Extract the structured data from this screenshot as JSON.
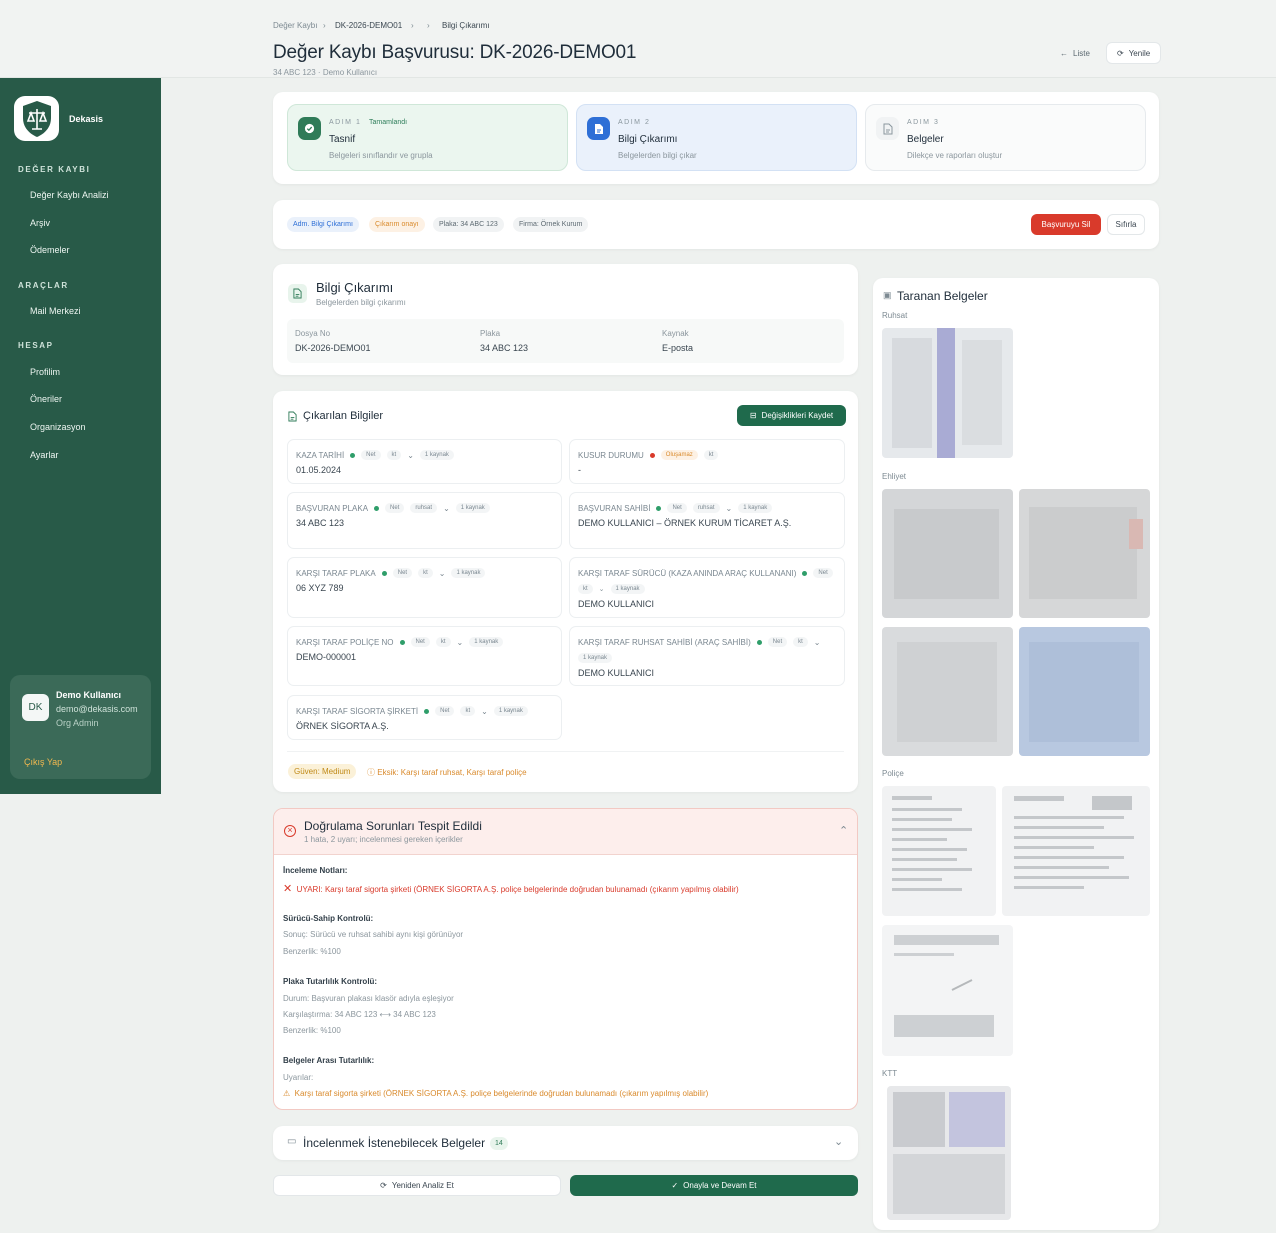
{
  "breadcrumb": {
    "items": [
      "Değer Kaybı",
      "DK-2026-DEMO01",
      "Bilgi Çıkarımı"
    ]
  },
  "header": {
    "title": "Değer Kaybı Başvurusu: DK-2026-DEMO01",
    "plate": "34 ABC 123",
    "user": "Demo Kullanıcı",
    "list_label": "Liste",
    "refresh_label": "Yenile"
  },
  "sidebar": {
    "brand": "Dekasis",
    "sections": [
      {
        "title": "DEĞER KAYBI",
        "items": [
          "Değer Kaybı Analizi",
          "Arşiv",
          "Ödemeler"
        ]
      },
      {
        "title": "ARAÇLAR",
        "items": [
          "Mail Merkezi"
        ]
      },
      {
        "title": "HESAP",
        "items": [
          "Profilim",
          "Öneriler",
          "Organizasyon",
          "Ayarlar"
        ]
      }
    ],
    "user": {
      "initials": "DK",
      "name": "Demo Kullanıcı",
      "email": "demo@dekasis.com",
      "role": "Org Admin",
      "logout": "Çıkış Yap"
    }
  },
  "steps": [
    {
      "label": "ADIM 1",
      "status": "Tamamlandı",
      "title": "Tasnif",
      "desc": "Belgeleri sınıflandır ve grupla"
    },
    {
      "label": "ADIM 2",
      "title": "Bilgi Çıkarımı",
      "desc": "Belgelerden bilgi çıkar"
    },
    {
      "label": "ADIM 3",
      "title": "Belgeler",
      "desc": "Dilekçe ve raporları oluştur"
    }
  ],
  "status_bar": {
    "pills": [
      "Adm. Bilgi Çıkarımı",
      "Çıkarım onayı",
      "Plaka: 34 ABC 123",
      "Firma: Örnek Kurum"
    ],
    "delete_label": "Başvuruyu Sil",
    "reset_label": "Sıfırla"
  },
  "info": {
    "title": "Bilgi Çıkarımı",
    "subtitle": "Belgelerden bilgi çıkarımı",
    "fields": [
      {
        "label": "Dosya No",
        "value": "DK-2026-DEMO01"
      },
      {
        "label": "Plaka",
        "value": "34 ABC 123"
      },
      {
        "label": "Kaynak",
        "value": "E-posta"
      }
    ]
  },
  "extracted": {
    "title": "Çıkarılan Bilgiler",
    "save_label": "Değişiklikleri Kaydet",
    "fields": [
      {
        "label": "KAZA TARİHİ",
        "tags": [
          "Net",
          "kt"
        ],
        "source": "1 kaynak",
        "value": "01.05.2024"
      },
      {
        "label": "KUSUR DURUMU",
        "status": "Oluşamaz",
        "tags": [
          "kt"
        ],
        "value": "-"
      },
      {
        "label": "BAŞVURAN PLAKA",
        "tags": [
          "Net",
          "ruhsat"
        ],
        "source": "1 kaynak",
        "value": "34 ABC 123"
      },
      {
        "label": "BAŞVURAN SAHİBİ",
        "tags": [
          "Net",
          "ruhsat"
        ],
        "source": "1 kaynak",
        "value": "DEMO KULLANICI – ÖRNEK KURUM TİCARET A.Ş."
      },
      {
        "label": "KARŞI TARAF PLAKA",
        "tags": [
          "Net",
          "kt"
        ],
        "source": "1 kaynak",
        "value": "06 XYZ 789"
      },
      {
        "label": "KARŞI TARAF SÜRÜCÜ (KAZA ANINDA ARAÇ KULLANANI)",
        "tags": [
          "Net",
          "kt"
        ],
        "source": "1 kaynak",
        "value": "DEMO KULLANICI"
      },
      {
        "label": "KARŞI TARAF POLİÇE NO",
        "tags": [
          "Net",
          "kt"
        ],
        "source": "1 kaynak",
        "value": "DEMO-000001"
      },
      {
        "label": "KARŞI TARAF RUHSAT SAHİBİ (ARAÇ SAHİBİ)",
        "tags": [
          "Net",
          "kt"
        ],
        "source": "1 kaynak",
        "value": "DEMO KULLANICI"
      },
      {
        "label": "KARŞI TARAF SİGORTA ŞİRKETİ",
        "tags": [
          "Net",
          "kt"
        ],
        "source": "1 kaynak",
        "value": "ÖRNEK SİGORTA A.Ş."
      }
    ],
    "confidence": "Güven: Medium",
    "missing": "Eksik: Karşı taraf ruhsat, Karşı taraf poliçe"
  },
  "validation": {
    "title": "Doğrulama Sorunları Tespit Edildi",
    "subtitle": "1 hata, 2 uyarı; incelenmesi gereken içerikler",
    "review_title": "İnceleme Notları:",
    "review_error": "UYARI: Karşı taraf sigorta şirketi (ÖRNEK SİGORTA A.Ş. poliçe belgelerinde doğrudan bulunamadı (çıkarım yapılmış olabilir)",
    "driver_title": "Sürücü-Sahip Kontrolü:",
    "driver_result": "Sonuç: Sürücü ve ruhsat sahibi aynı kişi görünüyor",
    "driver_sim": "Benzerlik: %100",
    "plate_title": "Plaka Tutarlılık Kontrolü:",
    "plate_status": "Durum: Başvuran plakası klasör adıyla eşleşiyor",
    "plate_compare": "Karşılaştırma: 34 ABC 123 ⟷ 34 ABC 123",
    "plate_sim": "Benzerlik: %100",
    "cross_title": "Belgeler Arası Tutarlılık:",
    "cross_warn_label": "Uyarılar:",
    "cross_warn": "Karşı taraf sigorta şirketi (ÖRNEK SİGORTA A.Ş. poliçe belgelerinde doğrudan bulunamadı (çıkarım yapılmış olabilir)"
  },
  "review_docs": {
    "title": "İncelenmek İstenebilecek Belgeler",
    "count": "14"
  },
  "actions": {
    "reanalyze": "Yeniden Analiz Et",
    "approve": "Onayla ve Devam Et"
  },
  "scanned": {
    "title": "Taranan Belgeler",
    "groups": [
      "Ruhsat",
      "Ehliyet",
      "Poliçe",
      "KTT"
    ]
  },
  "colors": {
    "sidebar": "#285a48",
    "accent": "#1f6a4c",
    "danger": "#d93a2b",
    "warning": "#d98a2c"
  }
}
